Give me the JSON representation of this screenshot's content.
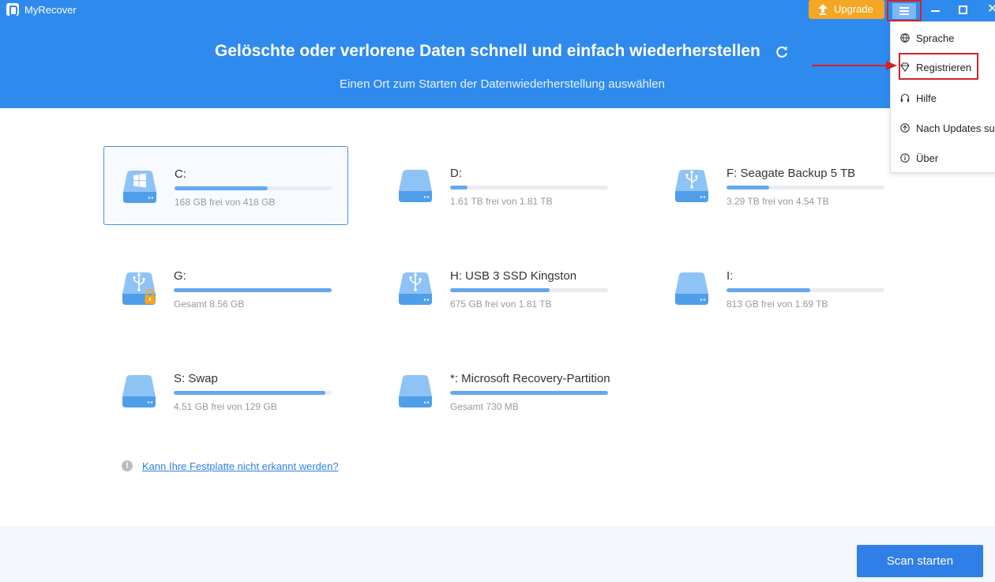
{
  "window": {
    "app_title": "MyRecover",
    "upgrade_label": "Upgrade",
    "close_glyph": "✕"
  },
  "header": {
    "title": "Gelöschte oder verlorene Daten schnell und einfach wiederherstellen",
    "subtitle": "Einen Ort zum Starten der Datenwiederherstellung auswählen"
  },
  "drives": [
    {
      "name": "C:",
      "info": "168 GB frei von 418 GB",
      "used_fraction": 0.59,
      "icon": "windows-drive-icon",
      "selected": true
    },
    {
      "name": "D:",
      "info": "1.61 TB frei von 1.81 TB",
      "used_fraction": 0.11,
      "icon": "hard-drive-icon",
      "selected": false
    },
    {
      "name": "F: Seagate Backup 5 TB",
      "info": "3.29 TB frei von 4.54 TB",
      "used_fraction": 0.27,
      "icon": "usb-drive-icon",
      "selected": false
    },
    {
      "name": "G:",
      "info": "Gesamt 8.56 GB",
      "used_fraction": 1.0,
      "icon": "locked-usb-drive-icon",
      "selected": false
    },
    {
      "name": "H: USB 3 SSD Kingston",
      "info": "675 GB frei von 1.81 TB",
      "used_fraction": 0.63,
      "icon": "usb-drive-icon",
      "selected": false
    },
    {
      "name": "I:",
      "info": "813 GB frei von 1.69 TB",
      "used_fraction": 0.53,
      "icon": "hard-drive-icon",
      "selected": false
    },
    {
      "name": "S: Swap",
      "info": "4.51 GB frei von 129 GB",
      "used_fraction": 0.96,
      "icon": "hard-drive-icon",
      "selected": false
    },
    {
      "name": "*: Microsoft Recovery-Partition",
      "info": "Gesamt 730 MB",
      "used_fraction": 1.0,
      "icon": "hard-drive-icon",
      "selected": false
    }
  ],
  "help": {
    "glyph": "!",
    "link_text": "Kann Ihre Festplatte nicht erkannt werden?"
  },
  "footer": {
    "scan_button": "Scan starten"
  },
  "menu": {
    "items": [
      {
        "label": "Sprache",
        "icon": "globe-icon"
      },
      {
        "label": "Registrieren",
        "icon": "diamond-icon"
      },
      {
        "label": "Hilfe",
        "icon": "headset-icon"
      },
      {
        "label": "Nach Updates su",
        "icon": "update-icon"
      },
      {
        "label": "Über",
        "icon": "info-icon"
      }
    ]
  },
  "colors": {
    "header_bg": "#2f8aee",
    "accent": "#2f7fe6",
    "upgrade": "#f5a623",
    "highlight_box": "#d2232a",
    "bar_fill": "#64a8ee"
  }
}
